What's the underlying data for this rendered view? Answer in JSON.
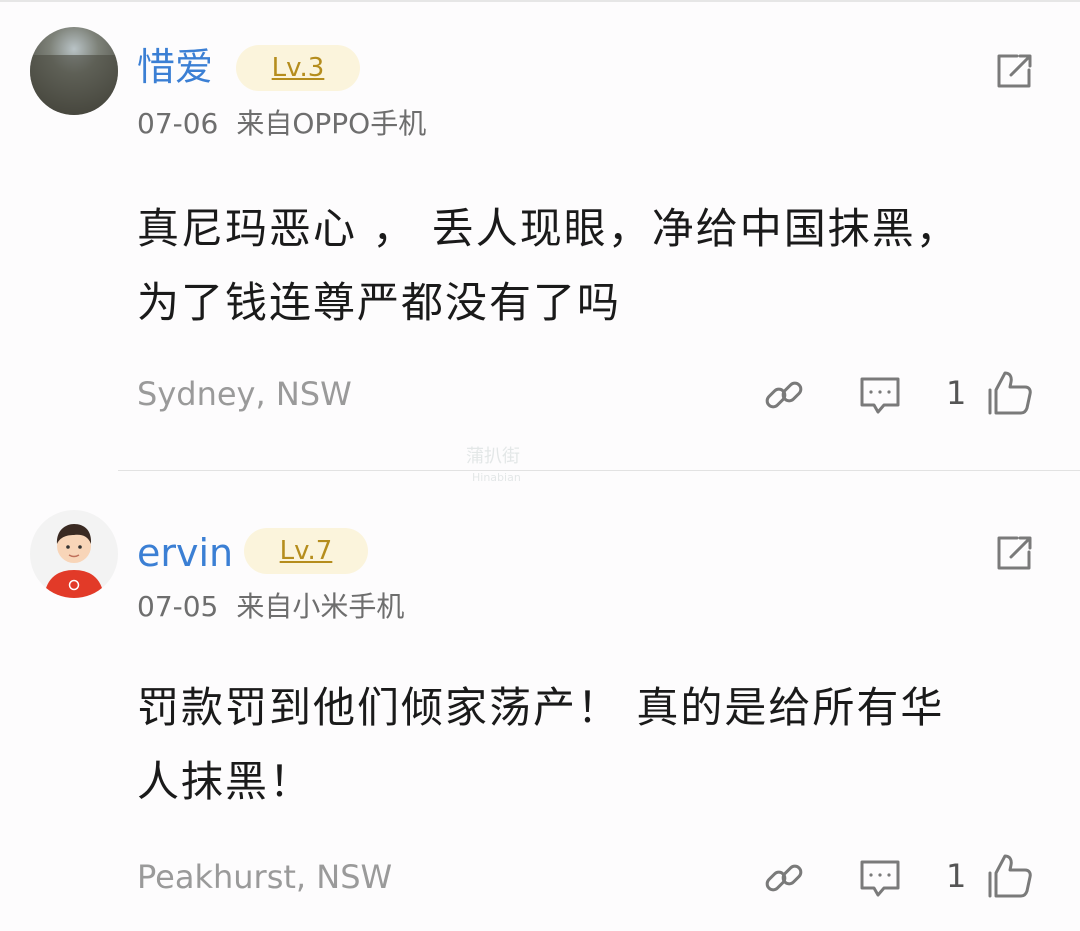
{
  "comments": [
    {
      "username": "惜爱",
      "level": "Lv.3",
      "date": "07-06",
      "source": "来自OPPO手机",
      "text_lines": [
        "真尼玛恶心 ， 丢人现眼，净给中国抹黑，",
        "为了钱连尊严都没有了吗"
      ],
      "location": "Sydney, NSW",
      "like_count": "1"
    },
    {
      "username": "ervin",
      "level": "Lv.7",
      "date": "07-05",
      "source": "来自小米手机",
      "text_lines": [
        "罚款罚到他们倾家荡产！ 真的是给所有华",
        "人抹黑！"
      ],
      "location": "Peakhurst, NSW",
      "like_count": "1"
    }
  ],
  "watermark": {
    "main": "蒲扒街",
    "sub": "Hinabian"
  },
  "colors": {
    "username": "#3b7fd4",
    "level_bg": "#fbf4dc",
    "level_text": "#b58d1d",
    "muted": "#9a9a9a"
  }
}
